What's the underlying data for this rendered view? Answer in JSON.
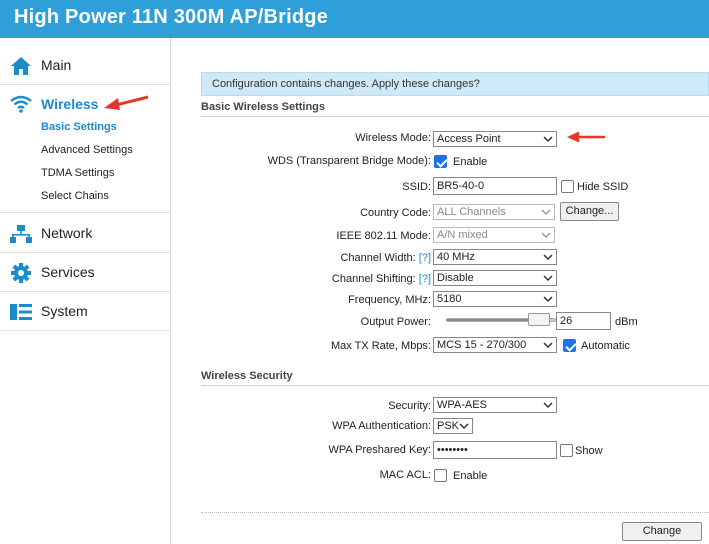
{
  "app": {
    "title": "High Power 11N 300M AP/Bridge"
  },
  "sidebar": {
    "items": [
      {
        "label": "Main",
        "icon": "home-icon"
      },
      {
        "label": "Wireless",
        "icon": "wifi-icon",
        "active": true,
        "sub": [
          {
            "label": "Basic Settings",
            "active": true
          },
          {
            "label": "Advanced Settings"
          },
          {
            "label": "TDMA Settings"
          },
          {
            "label": "Select Chains"
          }
        ]
      },
      {
        "label": "Network",
        "icon": "network-icon"
      },
      {
        "label": "Services",
        "icon": "gear-icon"
      },
      {
        "label": "System",
        "icon": "system-icon"
      }
    ]
  },
  "notice": {
    "text": "Configuration contains changes. Apply these changes?"
  },
  "basic": {
    "title": "Basic Wireless Settings",
    "wireless_mode": {
      "label": "Wireless Mode:",
      "value": "Access Point"
    },
    "wds": {
      "label": "WDS (Transparent Bridge Mode):",
      "checked": true,
      "option": "Enable"
    },
    "ssid": {
      "label": "SSID:",
      "value": "BR5-40-0",
      "hide_label": "Hide SSID",
      "hide_checked": false
    },
    "country": {
      "label": "Country Code:",
      "value": "ALL Channels",
      "button": "Change..."
    },
    "ieee": {
      "label": "IEEE 802.11 Mode:",
      "value": "A/N mixed"
    },
    "channel_width": {
      "label": "Channel Width:",
      "help": "[?]",
      "value": "40 MHz"
    },
    "channel_shifting": {
      "label": "Channel Shifting:",
      "help": "[?]",
      "value": "Disable"
    },
    "frequency": {
      "label": "Frequency, MHz:",
      "value": "5180"
    },
    "output_power": {
      "label": "Output Power:",
      "value": "26",
      "unit": "dBm",
      "slider_fraction": 0.95
    },
    "max_tx": {
      "label": "Max TX Rate, Mbps:",
      "value": "MCS 15 - 270/300",
      "auto_label": "Automatic",
      "auto_checked": true
    }
  },
  "security": {
    "title": "Wireless Security",
    "security": {
      "label": "Security:",
      "value": "WPA-AES"
    },
    "wpa_auth": {
      "label": "WPA Authentication:",
      "value": "PSK"
    },
    "psk": {
      "label": "WPA Preshared Key:",
      "value": "••••••••",
      "show_label": "Show",
      "show_checked": false
    },
    "mac_acl": {
      "label": "MAC ACL:",
      "option": "Enable",
      "checked": false
    }
  },
  "footer": {
    "change_button": "Change"
  },
  "colors": {
    "header": "#2e9fd8",
    "accent": "#1a8ccc",
    "arrow": "#e8342a",
    "notice": "#cfe9f7"
  }
}
